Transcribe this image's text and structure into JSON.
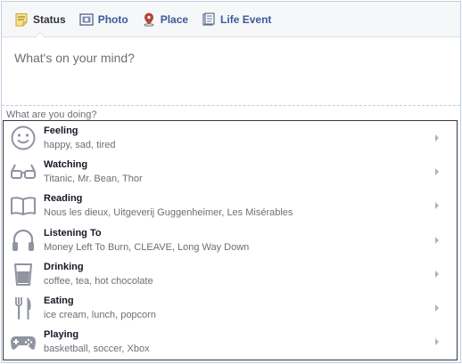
{
  "tabs": [
    {
      "label": "Status",
      "icon": "status-icon",
      "active": true
    },
    {
      "label": "Photo",
      "icon": "photo-icon",
      "active": false
    },
    {
      "label": "Place",
      "icon": "place-icon",
      "active": false
    },
    {
      "label": "Life Event",
      "icon": "life-event-icon",
      "active": false
    }
  ],
  "composer": {
    "placeholder": "What's on your mind?",
    "doing_label": "What are you doing?"
  },
  "activities": [
    {
      "name": "Feeling",
      "examples": "happy, sad, tired",
      "icon": "smiley-icon"
    },
    {
      "name": "Watching",
      "examples": "Titanic, Mr. Bean, Thor",
      "icon": "glasses-icon"
    },
    {
      "name": "Reading",
      "examples": "Nous les dieux, Uitgeverij Guggenheimer, Les Misérables",
      "icon": "book-icon"
    },
    {
      "name": "Listening To",
      "examples": "Money Left To Burn, CLEAVE, Long Way Down",
      "icon": "headphones-icon"
    },
    {
      "name": "Drinking",
      "examples": "coffee, tea, hot chocolate",
      "icon": "cup-icon"
    },
    {
      "name": "Eating",
      "examples": "ice cream, lunch, popcorn",
      "icon": "fork-knife-icon"
    },
    {
      "name": "Playing",
      "examples": "basketball, soccer, Xbox",
      "icon": "gamepad-icon"
    }
  ],
  "colors": {
    "link": "#3b5998",
    "icon_gray": "#8f94a0",
    "chevron": "#a8b2c8"
  }
}
